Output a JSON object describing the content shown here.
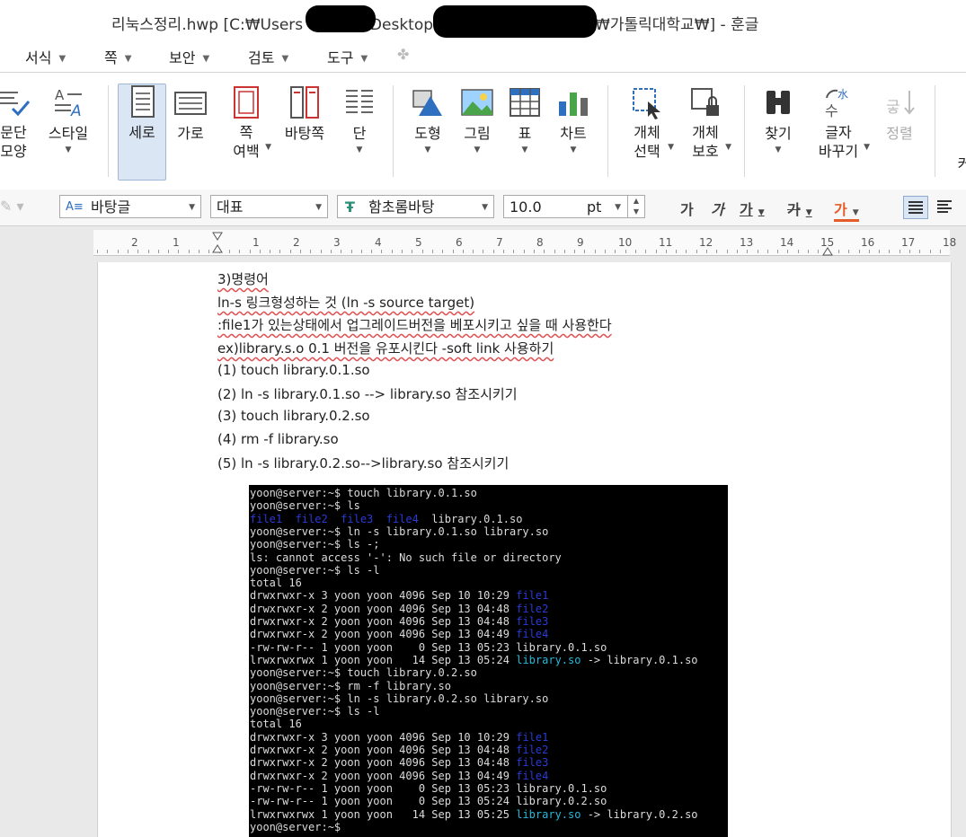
{
  "window": {
    "title_prefix": "리눅스정리.hwp [C:₩Users",
    "title_mid": "₩Desktop",
    "title_suffix": "₩가톨릭대학교₩] - 훈글"
  },
  "menu": {
    "items": [
      {
        "label": "서식"
      },
      {
        "label": "쪽"
      },
      {
        "label": "보안"
      },
      {
        "label": "검토"
      },
      {
        "label": "도구"
      }
    ]
  },
  "ribbon": {
    "paragraph_shape": "문단\n모양",
    "style": "스타일",
    "vertical": "세로",
    "horizontal": "가로",
    "margin": "쪽\n여백",
    "master_page": "바탕쪽",
    "columns": "단",
    "shape": "도형",
    "picture": "그림",
    "table": "표",
    "chart": "차트",
    "select_object": "개체\n선택",
    "protect_object": "개체\n보호",
    "find": "찾기",
    "replace_text": "글자\n바꾸기",
    "sort": "정렬",
    "cut_off": "커"
  },
  "format": {
    "style": "바탕글",
    "language": "대표",
    "font": "함초롬바탕",
    "size": "10.0",
    "unit": "pt",
    "bold": "가",
    "italic": "가",
    "underline": "가",
    "strike": "가",
    "color": "가"
  },
  "ruler": {
    "numbers": [
      "2",
      "1",
      "1",
      "2",
      "3",
      "4",
      "5",
      "6",
      "7",
      "8",
      "9",
      "10",
      "11",
      "12",
      "13",
      "14",
      "15",
      "16",
      "17",
      "18"
    ]
  },
  "document": {
    "lines": [
      "3)명령어",
      " ln-s 링크형성하는 것 (ln -s source target)",
      ":file1가 있는상태에서 업그레이드버전을 베포시키고 싶을 때 사용한다",
      "ex)library.s.o 0.1 버전을 유포시킨다 -soft link 사용하기",
      "(1) touch library.0.1.so",
      "(2) ln -s library.0.1.so --> library.so  참조시키기",
      "(3) touch library.0.2.so",
      "(4) rm -f library.so",
      "(5) ln -s library.0.2.so-->library.so 참조시키기"
    ]
  },
  "terminal": {
    "lines": [
      [
        {
          "t": "yoon@server:~$ touch library.0.1.so"
        }
      ],
      [
        {
          "t": "yoon@server:~$ ls"
        }
      ],
      [
        {
          "t": "file1  file2  file3  file4",
          "c": "blue"
        },
        {
          "t": "  library.0.1.so"
        }
      ],
      [
        {
          "t": "yoon@server:~$ ln -s library.0.1.so library.so"
        }
      ],
      [
        {
          "t": "yoon@server:~$ ls -;"
        }
      ],
      [
        {
          "t": "ls: cannot access '-': No such file or directory"
        }
      ],
      [
        {
          "t": "yoon@server:~$ ls -l"
        }
      ],
      [
        {
          "t": "total 16"
        }
      ],
      [
        {
          "t": "drwxrwxr-x 3 yoon yoon 4096 Sep 10 10:29 "
        },
        {
          "t": "file1",
          "c": "blue"
        }
      ],
      [
        {
          "t": "drwxrwxr-x 2 yoon yoon 4096 Sep 13 04:48 "
        },
        {
          "t": "file2",
          "c": "blue"
        }
      ],
      [
        {
          "t": "drwxrwxr-x 2 yoon yoon 4096 Sep 13 04:48 "
        },
        {
          "t": "file3",
          "c": "blue"
        }
      ],
      [
        {
          "t": "drwxrwxr-x 2 yoon yoon 4096 Sep 13 04:49 "
        },
        {
          "t": "file4",
          "c": "blue"
        }
      ],
      [
        {
          "t": "-rw-rw-r-- 1 yoon yoon    0 Sep 13 05:23 library.0.1.so"
        }
      ],
      [
        {
          "t": "lrwxrwxrwx 1 yoon yoon   14 Sep 13 05:24 "
        },
        {
          "t": "library.so",
          "c": "cyan"
        },
        {
          "t": " -> library.0.1.so"
        }
      ],
      [
        {
          "t": "yoon@server:~$ touch library.0.2.so"
        }
      ],
      [
        {
          "t": "yoon@server:~$ rm -f library.so"
        }
      ],
      [
        {
          "t": "yoon@server:~$ ln -s library.0.2.so library.so"
        }
      ],
      [
        {
          "t": "yoon@server:~$ ls -l"
        }
      ],
      [
        {
          "t": "total 16"
        }
      ],
      [
        {
          "t": "drwxrwxr-x 3 yoon yoon 4096 Sep 10 10:29 "
        },
        {
          "t": "file1",
          "c": "blue"
        }
      ],
      [
        {
          "t": "drwxrwxr-x 2 yoon yoon 4096 Sep 13 04:48 "
        },
        {
          "t": "file2",
          "c": "blue"
        }
      ],
      [
        {
          "t": "drwxrwxr-x 2 yoon yoon 4096 Sep 13 04:48 "
        },
        {
          "t": "file3",
          "c": "blue"
        }
      ],
      [
        {
          "t": "drwxrwxr-x 2 yoon yoon 4096 Sep 13 04:49 "
        },
        {
          "t": "file4",
          "c": "blue"
        }
      ],
      [
        {
          "t": "-rw-rw-r-- 1 yoon yoon    0 Sep 13 05:23 library.0.1.so"
        }
      ],
      [
        {
          "t": "-rw-rw-r-- 1 yoon yoon    0 Sep 13 05:24 library.0.2.so"
        }
      ],
      [
        {
          "t": "lrwxrwxrwx 1 yoon yoon   14 Sep 13 05:25 "
        },
        {
          "t": "library.so",
          "c": "cyan"
        },
        {
          "t": " -> library.0.2.so"
        }
      ],
      [
        {
          "t": "yoon@server:~$"
        }
      ]
    ]
  }
}
